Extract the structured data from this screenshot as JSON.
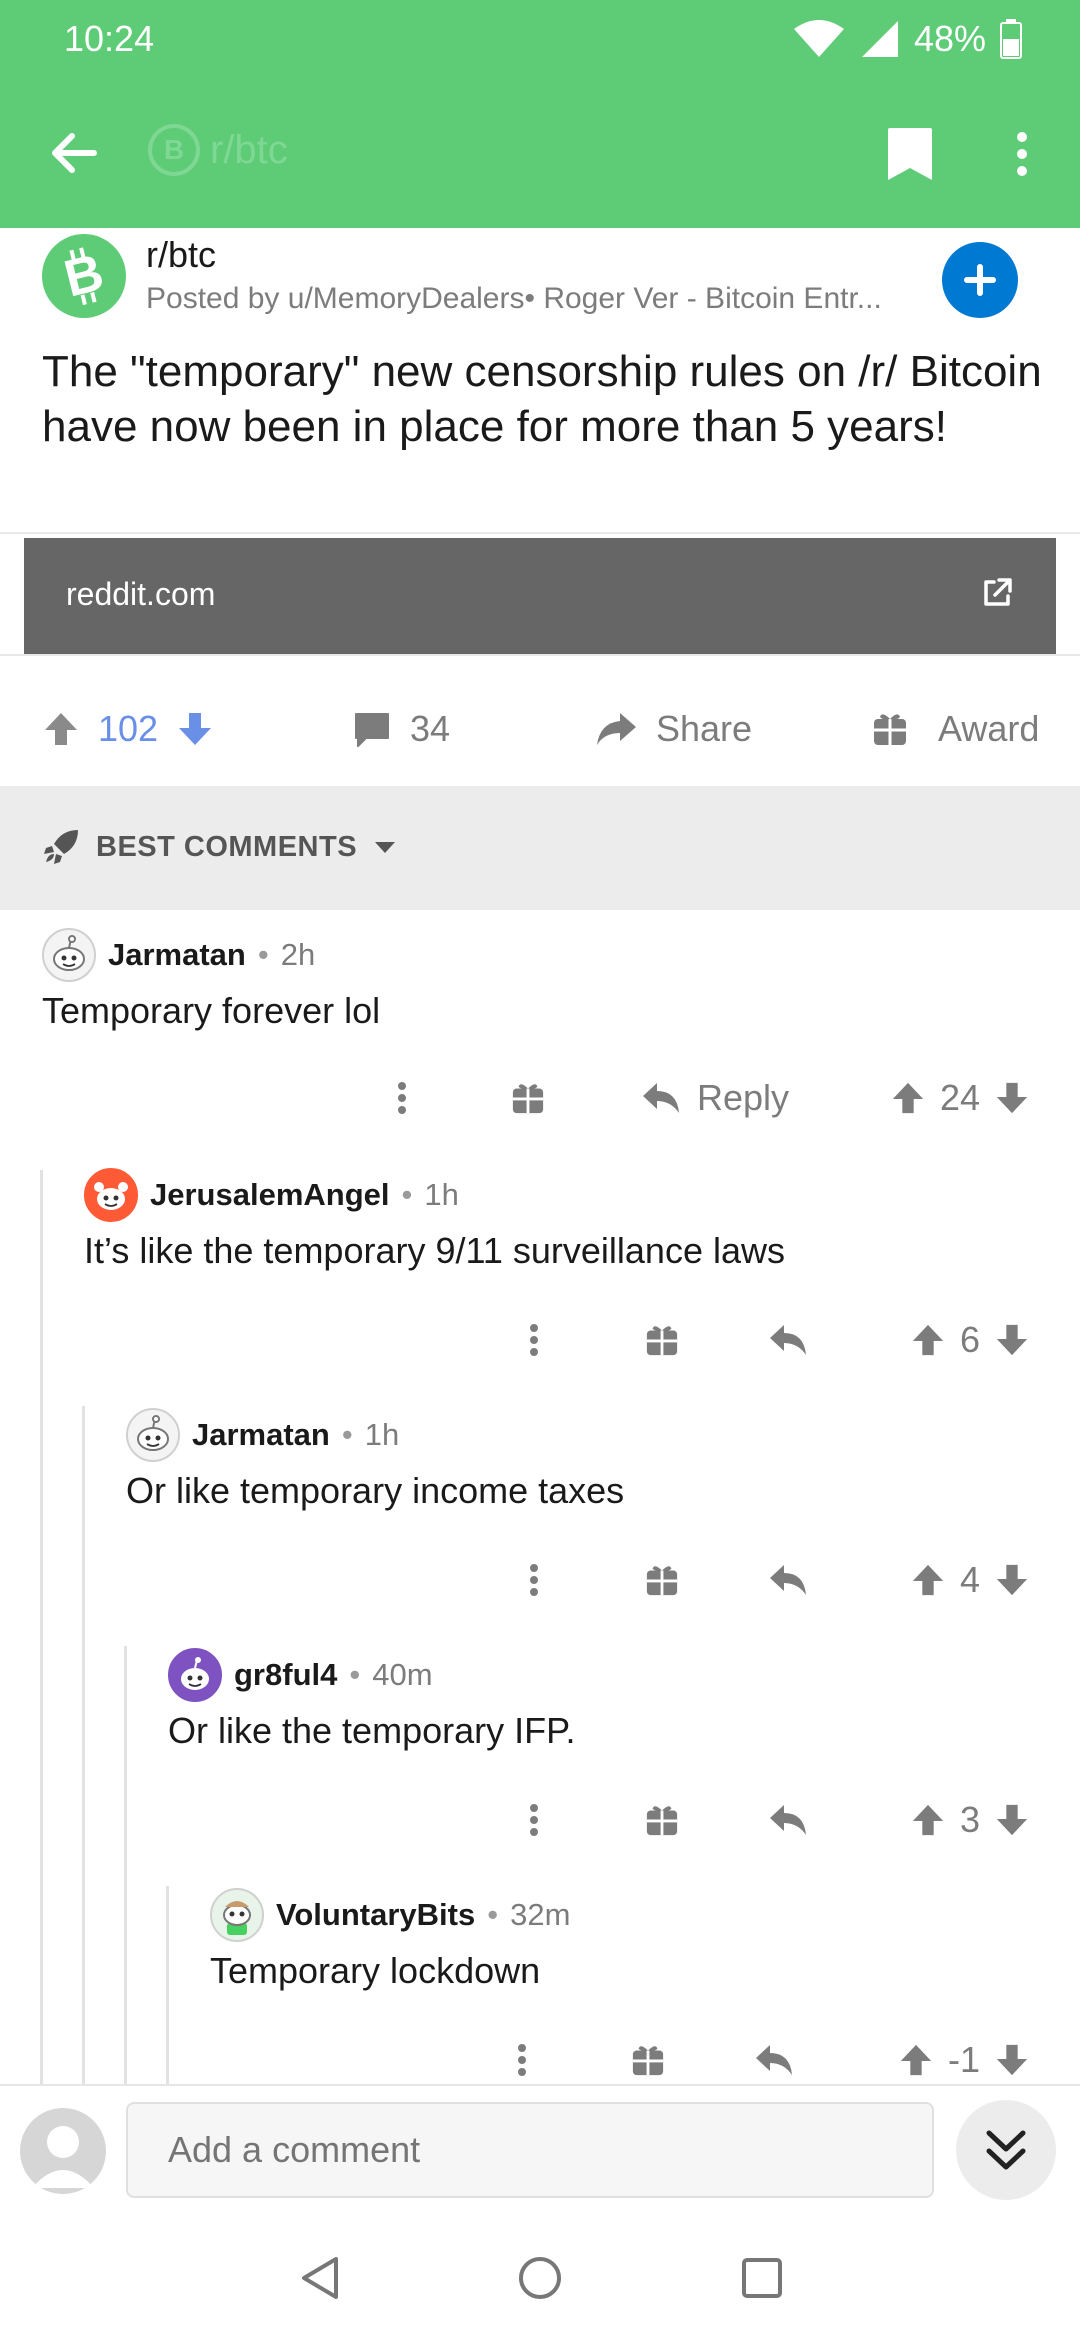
{
  "status_bar": {
    "time": "10:24",
    "battery": "48%"
  },
  "app_bar": {
    "faded_title": "r/btc",
    "logo_letter": "B"
  },
  "post": {
    "subreddit": "r/btc",
    "posted_by": "Posted by u/MemoryDealers• Roger Ver - Bitcoin Entr...",
    "title": "The \"temporary\" new censorship rules on /r/ Bitcoin have now been in place for more than 5 years!",
    "link_domain": "reddit.com",
    "score": "102",
    "comments_count": "34",
    "share_label": "Share",
    "award_label": "Award"
  },
  "sort": {
    "label": "BEST COMMENTS"
  },
  "comments": [
    {
      "author": "Jarmatan",
      "sep": "•",
      "age": "2h",
      "body": "Temporary forever lol",
      "reply_label": "Reply",
      "score": "24"
    },
    {
      "author": "JerusalemAngel",
      "sep": "•",
      "age": "1h",
      "body": "It’s like the temporary 9/11 surveillance laws",
      "score": "6"
    },
    {
      "author": "Jarmatan",
      "sep": "•",
      "age": "1h",
      "body": "Or like temporary income taxes",
      "score": "4"
    },
    {
      "author": "gr8ful4",
      "sep": "•",
      "age": "40m",
      "body": "Or like the temporary IFP.",
      "score": "3"
    },
    {
      "author": "VoluntaryBits",
      "sep": "•",
      "age": "32m",
      "body": "Temporary lockdown",
      "score": "-1"
    }
  ],
  "composer": {
    "placeholder": "Add a comment"
  },
  "colors": {
    "accent_green": "#5ecb77",
    "upvote_blue": "#6a8fe6",
    "join_blue": "#0079d3",
    "link_card": "#666666"
  },
  "icons": [
    "back-arrow-icon",
    "bookmark-icon",
    "more-vertical-icon",
    "bitcoin-logo-icon",
    "plus-icon",
    "external-link-icon",
    "upvote-icon",
    "downvote-icon",
    "comment-icon",
    "share-icon",
    "award-icon",
    "rocket-icon",
    "chevron-down-icon",
    "reply-icon",
    "double-chevron-down-icon"
  ]
}
